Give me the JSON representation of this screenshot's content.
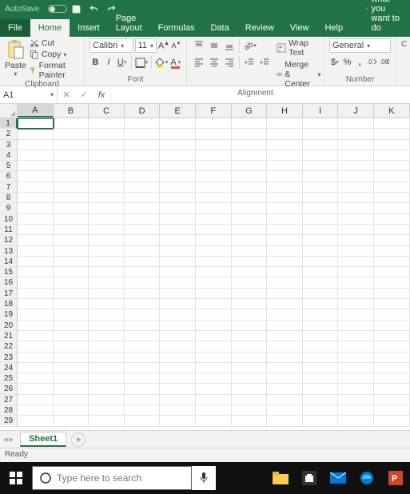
{
  "titlebar": {
    "autosave": "AutoSave"
  },
  "tabs": {
    "file": "File",
    "home": "Home",
    "insert": "Insert",
    "page_layout": "Page Layout",
    "formulas": "Formulas",
    "data": "Data",
    "review": "Review",
    "view": "View",
    "help": "Help",
    "tellme": "Tell me what you want to do"
  },
  "ribbon": {
    "clipboard": {
      "paste": "Paste",
      "cut": "Cut",
      "copy": "Copy",
      "format_painter": "Format Painter",
      "label": "Clipboard"
    },
    "font": {
      "name": "Calibri",
      "size": "11",
      "label": "Font"
    },
    "alignment": {
      "wrap": "Wrap Text",
      "merge": "Merge & Center",
      "label": "Alignment"
    },
    "number": {
      "format": "General",
      "label": "Number"
    }
  },
  "namebox": {
    "ref": "A1"
  },
  "columns": [
    "A",
    "B",
    "C",
    "D",
    "E",
    "F",
    "G",
    "H",
    "I",
    "J",
    "K"
  ],
  "rows": [
    "1",
    "2",
    "3",
    "4",
    "5",
    "6",
    "7",
    "8",
    "9",
    "10",
    "11",
    "12",
    "13",
    "14",
    "15",
    "16",
    "17",
    "18",
    "19",
    "20",
    "21",
    "22",
    "23",
    "24",
    "25",
    "26",
    "27",
    "28",
    "29"
  ],
  "selected": {
    "col": 0,
    "row": 0
  },
  "sheets": {
    "active": "Sheet1"
  },
  "status": {
    "ready": "Ready"
  },
  "taskbar": {
    "search_placeholder": "Type here to search"
  }
}
